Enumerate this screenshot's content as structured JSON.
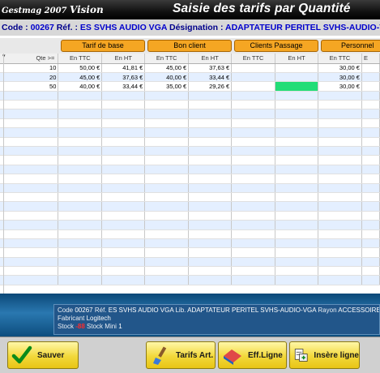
{
  "titlebar": {
    "app_name": "Gestmag 2007 ",
    "app_name_bold": "Vision",
    "title": "Saisie des tarifs par Quantité"
  },
  "infoline": {
    "code_label": "Code : ",
    "code": "00267",
    "ref_label": " Réf. : ",
    "ref": "ES SVHS AUDIO VGA",
    "desig_label": " Désignation : ",
    "desig": "ADAPTATEUR PERITEL SVHS-AUDIO-VGA"
  },
  "groups": [
    "Tarif de base",
    "Bon client",
    "Clients Passage",
    "Personnel"
  ],
  "columns": {
    "qte": "Qte >=",
    "ttc": "En TTC",
    "ht": "En HT",
    "last": "E"
  },
  "rows": [
    {
      "qte": "10",
      "c1": "50,00 €",
      "c2": "41,81 €",
      "c3": "45,00 €",
      "c4": "37,63 €",
      "c5": "",
      "c6": "",
      "c7": "30,00 €"
    },
    {
      "qte": "20",
      "c1": "45,00 €",
      "c2": "37,63 €",
      "c3": "40,00 €",
      "c4": "33,44 €",
      "c5": "",
      "c6": "",
      "c7": "30,00 €"
    },
    {
      "qte": "50",
      "c1": "40,00 €",
      "c2": "33,44 €",
      "c3": "35,00 €",
      "c4": "29,26 €",
      "c5": "",
      "c6": "",
      "c7": "30,00 €"
    }
  ],
  "info": {
    "code_label": "Code",
    "code": "00267",
    "ref_label": "Réf.",
    "ref": "ES SVHS AUDIO VGA",
    "lib_label": "Lib.",
    "lib": "ADAPTATEUR PERITEL SVHS-AUDIO-VGA",
    "rayon_label": "Rayon",
    "rayon": "ACCESSOIRES / ACCESSOIRES",
    "fabricant_label": "Fabricant",
    "fabricant": "Logitech",
    "stock_label": "Stock",
    "stock": "-88",
    "stock_mini_label": "Stock Mini",
    "stock_mini": "1"
  },
  "buttons": {
    "sauver": "Sauver",
    "tarifs": "Tarifs Art.",
    "eff": "Eff.Ligne",
    "insere": "Insère ligne"
  },
  "colors": {
    "title_bg": "#000000",
    "group_orange": "#f5a623",
    "selected_cell": "#22dd77",
    "stock_negative": "#ff2a2a",
    "button_yellow": "#f2d83a"
  }
}
